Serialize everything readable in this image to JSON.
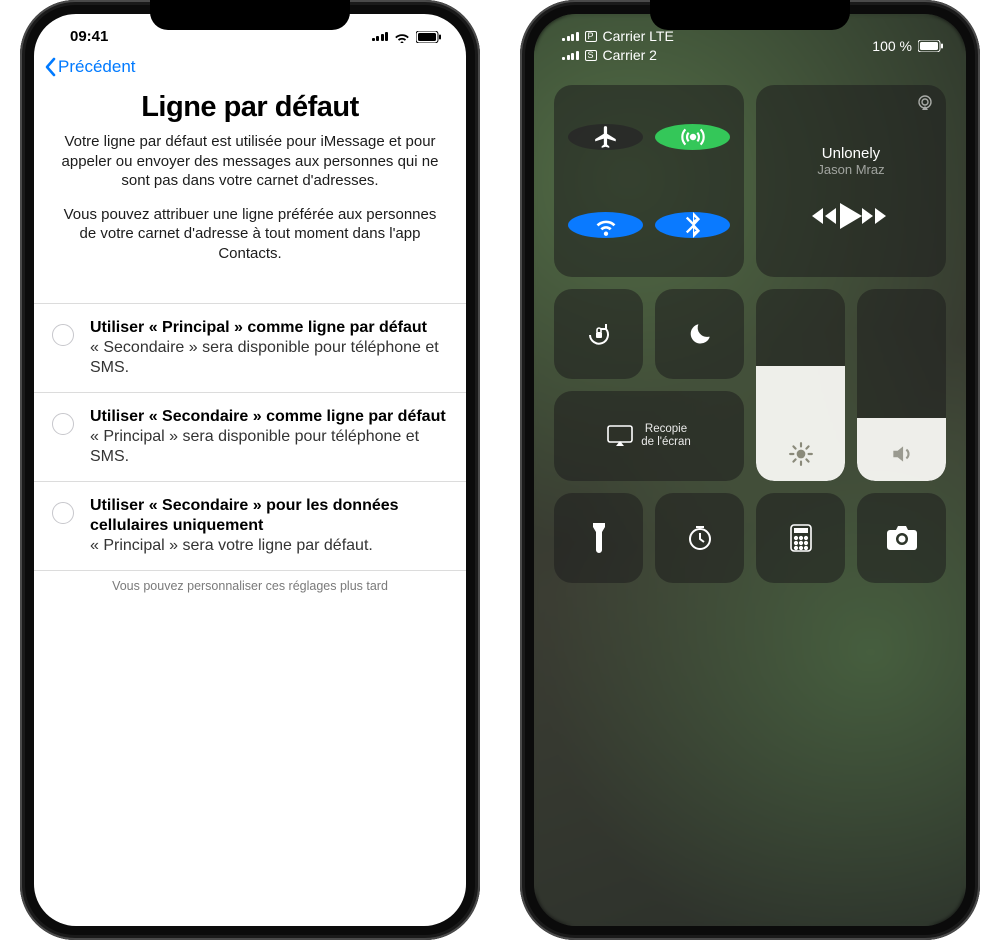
{
  "left": {
    "status": {
      "time": "09:41"
    },
    "nav": {
      "back": "Précédent"
    },
    "title": "Ligne par défaut",
    "para1": "Votre ligne par défaut est utilisée pour iMessage et pour appeler ou envoyer des messages aux personnes qui ne sont pas dans votre carnet d'adresses.",
    "para2": "Vous pouvez attribuer une ligne préférée aux personnes de votre carnet d'adresse à tout moment dans l'app Contacts.",
    "options": [
      {
        "title": "Utiliser « Principal » comme ligne par défaut",
        "sub": "« Secondaire » sera disponible pour téléphone et SMS."
      },
      {
        "title": "Utiliser « Secondaire » comme ligne par défaut",
        "sub": "« Principal » sera disponible pour téléphone et SMS."
      },
      {
        "title": "Utiliser « Secondaire » pour les données cellulaires uniquement",
        "sub": "« Principal » sera votre ligne par défaut."
      }
    ],
    "footer": "Vous pouvez personnaliser ces réglages plus tard"
  },
  "right": {
    "status": {
      "carrier1_sim": "P",
      "carrier1": "Carrier LTE",
      "carrier2_sim": "S",
      "carrier2": "Carrier 2",
      "battery": "100 %"
    },
    "music": {
      "title": "Unlonely",
      "artist": "Jason Mraz"
    },
    "mirror": {
      "line1": "Recopie",
      "line2": "de l'écran"
    },
    "connectivity": {
      "airplane": false,
      "cellular": true,
      "wifi": true,
      "bluetooth": true
    },
    "sliders": {
      "brightness": 0.6,
      "volume": 0.33
    }
  }
}
